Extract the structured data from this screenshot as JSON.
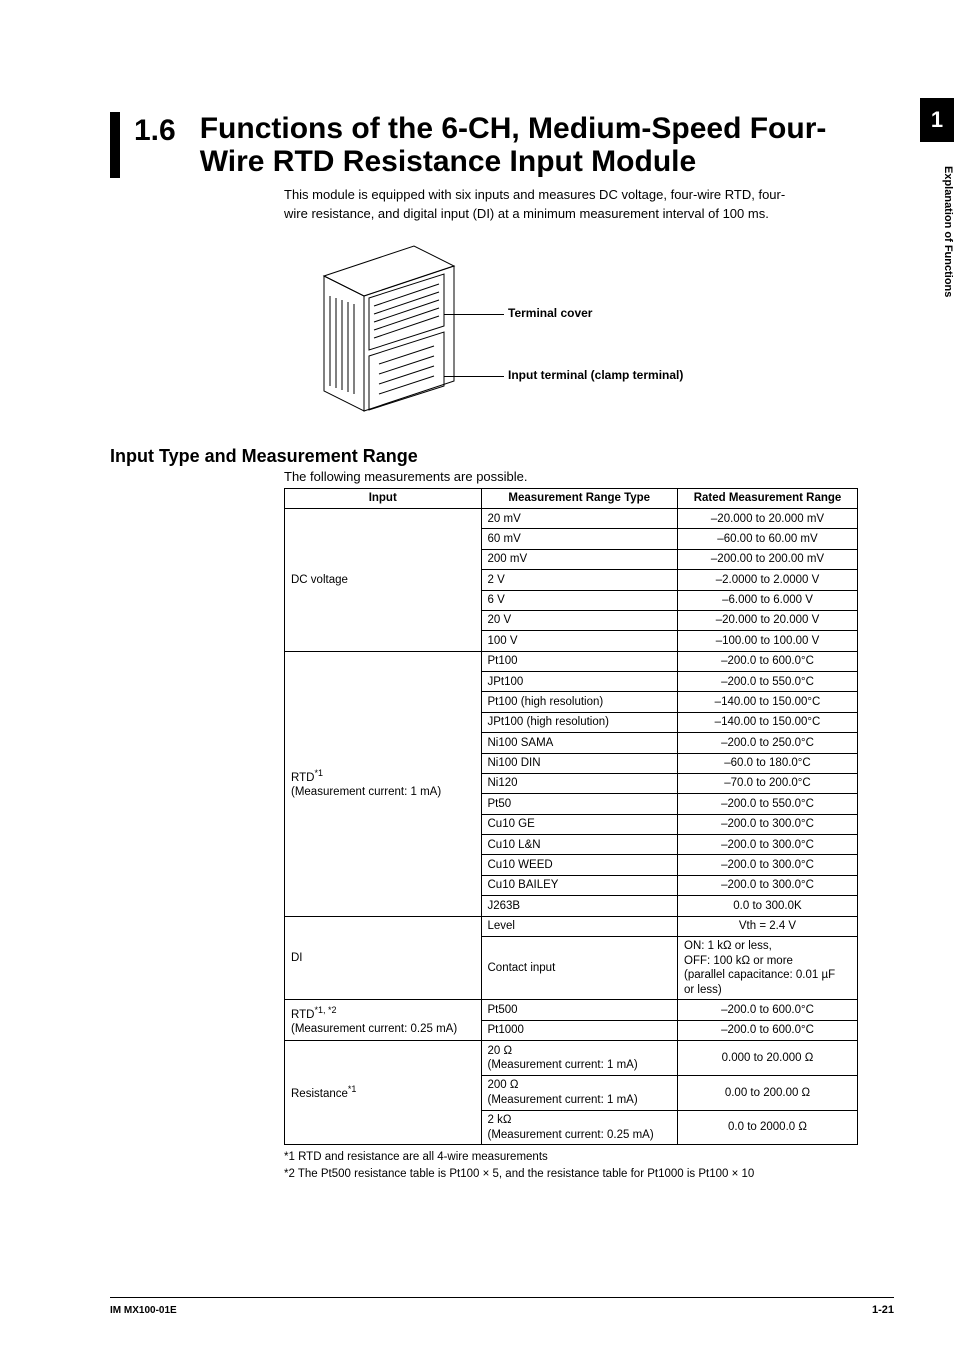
{
  "chapter_tab": "1",
  "side_label": "Explanation of Functions",
  "heading": {
    "number": "1.6",
    "title_line1": "Functions of the 6-CH, Medium-Speed Four-",
    "title_line2": "Wire RTD Resistance Input Module"
  },
  "intro_line1": "This module is equipped with six inputs and measures DC voltage, four-wire RTD, four-",
  "intro_line2": "wire resistance, and digital input (DI) at a minimum measurement interval of 100 ms.",
  "callouts": {
    "terminal_cover": "Terminal cover",
    "input_terminal": "Input terminal (clamp terminal)"
  },
  "subheading": "Input Type and Measurement Range",
  "subintro": "The following measurements are possible.",
  "table": {
    "headers": {
      "input": "Input",
      "range_type": "Measurement Range Type",
      "rated": "Rated Measurement Range"
    },
    "groups": [
      {
        "input": "DC voltage",
        "rows": [
          {
            "type": "20 mV",
            "rated": "–20.000 to 20.000 mV"
          },
          {
            "type": "60 mV",
            "rated": "–60.00 to 60.00 mV"
          },
          {
            "type": "200 mV",
            "rated": "–200.00 to 200.00 mV"
          },
          {
            "type": "2 V",
            "rated": "–2.0000 to 2.0000 V"
          },
          {
            "type": "6 V",
            "rated": "–6.000 to 6.000 V"
          },
          {
            "type": "20 V",
            "rated": "–20.000 to 20.000 V"
          },
          {
            "type": "100 V",
            "rated": "–100.00 to 100.00 V"
          }
        ]
      },
      {
        "input_main": "RTD",
        "input_sup": "*1",
        "input_sub": "(Measurement current: 1 mA)",
        "rows": [
          {
            "type": "Pt100",
            "rated": "–200.0 to 600.0°C"
          },
          {
            "type": "JPt100",
            "rated": "–200.0 to 550.0°C"
          },
          {
            "type": "Pt100 (high resolution)",
            "rated": "–140.00 to 150.00°C"
          },
          {
            "type": "JPt100 (high resolution)",
            "rated": "–140.00 to 150.00°C"
          },
          {
            "type": "Ni100 SAMA",
            "rated": "–200.0 to 250.0°C"
          },
          {
            "type": "Ni100 DIN",
            "rated": "–60.0 to 180.0°C"
          },
          {
            "type": "Ni120",
            "rated": "–70.0 to 200.0°C"
          },
          {
            "type": "Pt50",
            "rated": "–200.0 to 550.0°C"
          },
          {
            "type": "Cu10 GE",
            "rated": "–200.0 to 300.0°C"
          },
          {
            "type": "Cu10 L&N",
            "rated": "–200.0 to 300.0°C"
          },
          {
            "type": "Cu10 WEED",
            "rated": "–200.0 to 300.0°C"
          },
          {
            "type": "Cu10 BAILEY",
            "rated": "–200.0 to 300.0°C"
          },
          {
            "type": "J263B",
            "rated": "0.0 to 300.0K"
          }
        ]
      },
      {
        "input": "DI",
        "rows": [
          {
            "type": "Level",
            "rated": "Vth = 2.4 V"
          },
          {
            "type": "Contact input",
            "rated_lines": [
              "ON: 1 kΩ or less,",
              "OFF: 100 kΩ or more",
              "(parallel capacitance: 0.01 µF",
              "or less)"
            ]
          }
        ]
      },
      {
        "input_main": "RTD",
        "input_sup": "*1, *2",
        "input_sub": "(Measurement current: 0.25 mA)",
        "rows": [
          {
            "type": "Pt500",
            "rated": "–200.0 to 600.0°C"
          },
          {
            "type": "Pt1000",
            "rated": "–200.0 to 600.0°C"
          }
        ]
      },
      {
        "input_main": "Resistance",
        "input_sup": "*1",
        "rows": [
          {
            "type_lines": [
              "20 Ω",
              "(Measurement current: 1 mA)"
            ],
            "rated": "0.000 to 20.000 Ω"
          },
          {
            "type_lines": [
              "200 Ω",
              "(Measurement current: 1 mA)"
            ],
            "rated": "0.00 to 200.00 Ω"
          },
          {
            "type_lines": [
              "2 kΩ",
              "(Measurement current: 0.25 mA)"
            ],
            "rated": "0.0 to 2000.0 Ω"
          }
        ]
      }
    ]
  },
  "footnotes": {
    "fn1": "*1   RTD and resistance are all 4-wire measurements",
    "fn2": "*2   The Pt500 resistance table is Pt100 × 5, and the resistance table for Pt1000 is Pt100 × 10"
  },
  "footer": {
    "left": "IM MX100-01E",
    "right": "1-21"
  },
  "svg_paths": {
    "note": "Schematic isometric illustration of the module with terminal cover and clamp terminal."
  }
}
